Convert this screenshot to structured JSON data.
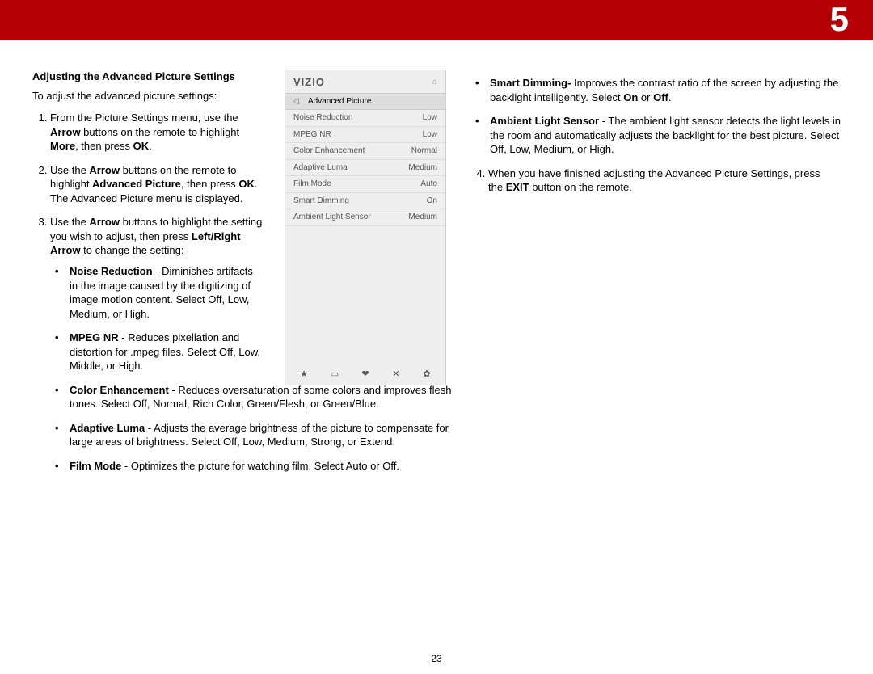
{
  "header": {
    "chapter_number": "5"
  },
  "footer": {
    "page_number": "23"
  },
  "left": {
    "title": "Adjusting the Advanced Picture Settings",
    "intro": "To adjust the advanced picture settings:",
    "step1_a": "From the Picture Settings menu, use the ",
    "step1_b": "Arrow",
    "step1_c": " buttons on the remote to highlight ",
    "step1_d": "More",
    "step1_e": ", then press ",
    "step1_f": "OK",
    "step1_g": ".",
    "step2_a": "Use the ",
    "step2_b": "Arrow",
    "step2_c": " buttons on the remote to highlight ",
    "step2_d": "Advanced Picture",
    "step2_e": ", then press ",
    "step2_f": "OK",
    "step2_g": ". The Advanced Picture menu is displayed.",
    "step3_a": "Use the ",
    "step3_b": "Arrow",
    "step3_c": " buttons to highlight the setting you wish to adjust, then press ",
    "step3_d": "Left/Right Arrow",
    "step3_e": " to change the setting:",
    "s3_1_t": "Noise Reduction",
    "s3_1_b": " - Diminishes artifacts in the image caused by the digitizing of image motion content. Select Off, Low, Medium, or High.",
    "s3_2_t": "MPEG NR",
    "s3_2_b": " - Reduces pixellation and distortion for .mpeg files. Select Off, Low, Middle, or High.",
    "s3_3_t": "Color Enhancement",
    "s3_3_b": " - Reduces oversaturation of some colors and improves flesh tones. Select Off, Normal, Rich Color, Green/Flesh, or Green/Blue.",
    "s3_4_t": "Adaptive Luma",
    "s3_4_b": " - Adjusts the average brightness of the picture to compensate for large areas of brightness. Select Off, Low, Medium, Strong, or Extend.",
    "s3_5_t": "Film Mode",
    "s3_5_b": " - Optimizes the picture for watching film. Select Auto or Off."
  },
  "right": {
    "s3_6_t": "Smart Dimming-",
    "s3_6_b": " Improves the contrast ratio of the screen by adjusting the backlight intelligently. Select ",
    "s3_6_c": "On",
    "s3_6_d": " or ",
    "s3_6_e": "Off",
    "s3_6_f": ".",
    "s3_7_t": "Ambient Light Sensor",
    "s3_7_b": " - The ambient light sensor detects the light levels in the room and automatically adjusts the backlight for the best picture. Select Off, Low, Medium, or High.",
    "step4_a": "When you have finished adjusting the Advanced Picture Settings, press the ",
    "step4_b": "EXIT",
    "step4_c": " button on the remote."
  },
  "tv": {
    "logo": "VIZIO",
    "title": "Advanced Picture",
    "rows": [
      {
        "label": "Noise Reduction",
        "value": "Low"
      },
      {
        "label": "MPEG NR",
        "value": "Low"
      },
      {
        "label": "Color Enhancement",
        "value": "Normal"
      },
      {
        "label": "Adaptive Luma",
        "value": "Medium"
      },
      {
        "label": "Film Mode",
        "value": "Auto"
      },
      {
        "label": "Smart Dimming",
        "value": "On"
      },
      {
        "label": "Ambient Light Sensor",
        "value": "Medium"
      }
    ]
  }
}
